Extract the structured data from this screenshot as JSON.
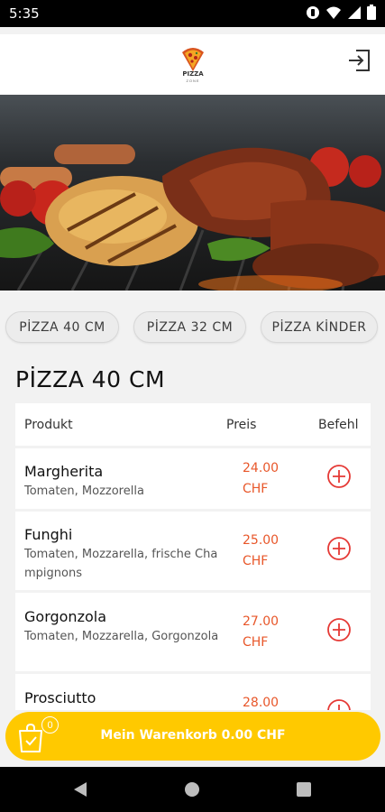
{
  "status_bar": {
    "time": "5:35",
    "icons": [
      "sync-icon",
      "wifi-icon",
      "signal-icon",
      "battery-icon"
    ]
  },
  "header": {
    "logo_text": "PIZZA",
    "logo_subtext": "ZONE",
    "logout_icon": "logout-icon"
  },
  "hero": {
    "image": "grilled-meat-photo"
  },
  "categories": [
    {
      "label": "PİZZA 40 CM"
    },
    {
      "label": "PİZZA 32 CM"
    },
    {
      "label": "PİZZA KİNDER"
    }
  ],
  "menu": {
    "title": "PİZZA 40 CM",
    "columns": {
      "product": "Produkt",
      "price": "Preis",
      "order": "Befehl"
    },
    "items": [
      {
        "name": "Margherita",
        "description": "Tomaten, Mozzorella",
        "price": "24.00 CHF"
      },
      {
        "name": "Funghi",
        "description": "Tomaten, Mozzarella, frische Champignons",
        "price": "25.00 CHF"
      },
      {
        "name": "Gorgonzola",
        "description": "Tomaten, Mozzarella, Gorgonzola",
        "price": "27.00 CHF"
      },
      {
        "name": "Prosciutto",
        "description": "",
        "price": "28.00 CHF"
      }
    ]
  },
  "cart": {
    "count": "0",
    "label": "Mein Warenkorb  0.00 CHF"
  },
  "colors": {
    "accent": "#ffc900",
    "price": "#e8572a",
    "add_button": "#e53935"
  }
}
